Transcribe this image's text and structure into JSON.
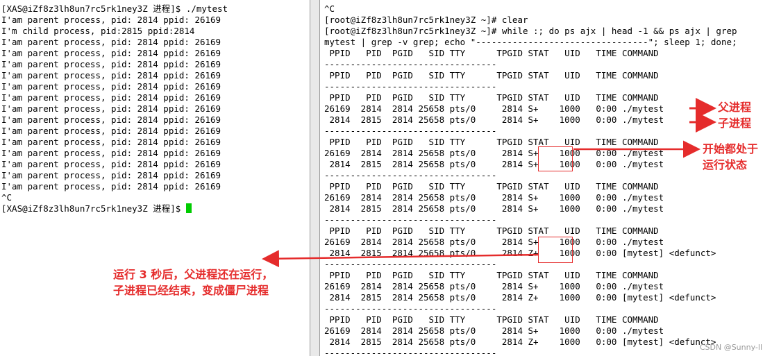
{
  "left_terminal": {
    "lines": [
      "[XAS@iZf8z3lh8un7rc5rk1ney3Z 进程]$ ./mytest",
      "I'am parent process, pid: 2814 ppid: 26169",
      "I'm child process, pid:2815 ppid:2814",
      "I'am parent process, pid: 2814 ppid: 26169",
      "I'am parent process, pid: 2814 ppid: 26169",
      "I'am parent process, pid: 2814 ppid: 26169",
      "I'am parent process, pid: 2814 ppid: 26169",
      "I'am parent process, pid: 2814 ppid: 26169",
      "I'am parent process, pid: 2814 ppid: 26169",
      "I'am parent process, pid: 2814 ppid: 26169",
      "I'am parent process, pid: 2814 ppid: 26169",
      "I'am parent process, pid: 2814 ppid: 26169",
      "I'am parent process, pid: 2814 ppid: 26169",
      "I'am parent process, pid: 2814 ppid: 26169",
      "I'am parent process, pid: 2814 ppid: 26169",
      "I'am parent process, pid: 2814 ppid: 26169",
      "I'am parent process, pid: 2814 ppid: 26169",
      "^C"
    ],
    "prompt": "[XAS@iZf8z3lh8un7rc5rk1ney3Z 进程]$ "
  },
  "right_terminal": {
    "lines": [
      "^C",
      "[root@iZf8z3lh8un7rc5rk1ney3Z ~]# clear",
      "[root@iZf8z3lh8un7rc5rk1ney3Z ~]# while :; do ps ajx | head -1 && ps ajx | grep",
      "mytest | grep -v grep; echo \"---------------------------------\"; sleep 1; done;",
      " PPID   PID  PGID   SID TTY      TPGID STAT   UID   TIME COMMAND",
      "---------------------------------",
      " PPID   PID  PGID   SID TTY      TPGID STAT   UID   TIME COMMAND",
      "---------------------------------",
      " PPID   PID  PGID   SID TTY      TPGID STAT   UID   TIME COMMAND",
      "26169  2814  2814 25658 pts/0     2814 S+    1000   0:00 ./mytest",
      " 2814  2815  2814 25658 pts/0     2814 S+    1000   0:00 ./mytest",
      "---------------------------------",
      " PPID   PID  PGID   SID TTY      TPGID STAT   UID   TIME COMMAND",
      "26169  2814  2814 25658 pts/0     2814 S+    1000   0:00 ./mytest",
      " 2814  2815  2814 25658 pts/0     2814 S+    1000   0:00 ./mytest",
      "---------------------------------",
      " PPID   PID  PGID   SID TTY      TPGID STAT   UID   TIME COMMAND",
      "26169  2814  2814 25658 pts/0     2814 S+    1000   0:00 ./mytest",
      " 2814  2815  2814 25658 pts/0     2814 S+    1000   0:00 ./mytest",
      "---------------------------------",
      " PPID   PID  PGID   SID TTY      TPGID STAT   UID   TIME COMMAND",
      "26169  2814  2814 25658 pts/0     2814 S+    1000   0:00 ./mytest",
      " 2814  2815  2814 25658 pts/0     2814 Z+    1000   0:00 [mytest] <defunct>",
      "---------------------------------",
      " PPID   PID  PGID   SID TTY      TPGID STAT   UID   TIME COMMAND",
      "26169  2814  2814 25658 pts/0     2814 S+    1000   0:00 ./mytest",
      " 2814  2815  2814 25658 pts/0     2814 Z+    1000   0:00 [mytest] <defunct>",
      "---------------------------------",
      " PPID   PID  PGID   SID TTY      TPGID STAT   UID   TIME COMMAND",
      "26169  2814  2814 25658 pts/0     2814 S+    1000   0:00 ./mytest",
      " 2814  2815  2814 25658 pts/0     2814 Z+    1000   0:00 [mytest] <defunct>",
      "---------------------------------"
    ]
  },
  "annotations": {
    "parent_label": "父进程",
    "child_label": "子进程",
    "running_line1": "开始都处于",
    "running_line2": "运行状态",
    "zombie_line1": "运行 3 秒后，父进程还在运行，",
    "zombie_line2": "子进程已经结束，变成僵尸进程"
  },
  "watermark": "CSDN @Sunny-ll",
  "colors": {
    "annotation": "#e52c2c",
    "cursor": "#00cc00"
  }
}
